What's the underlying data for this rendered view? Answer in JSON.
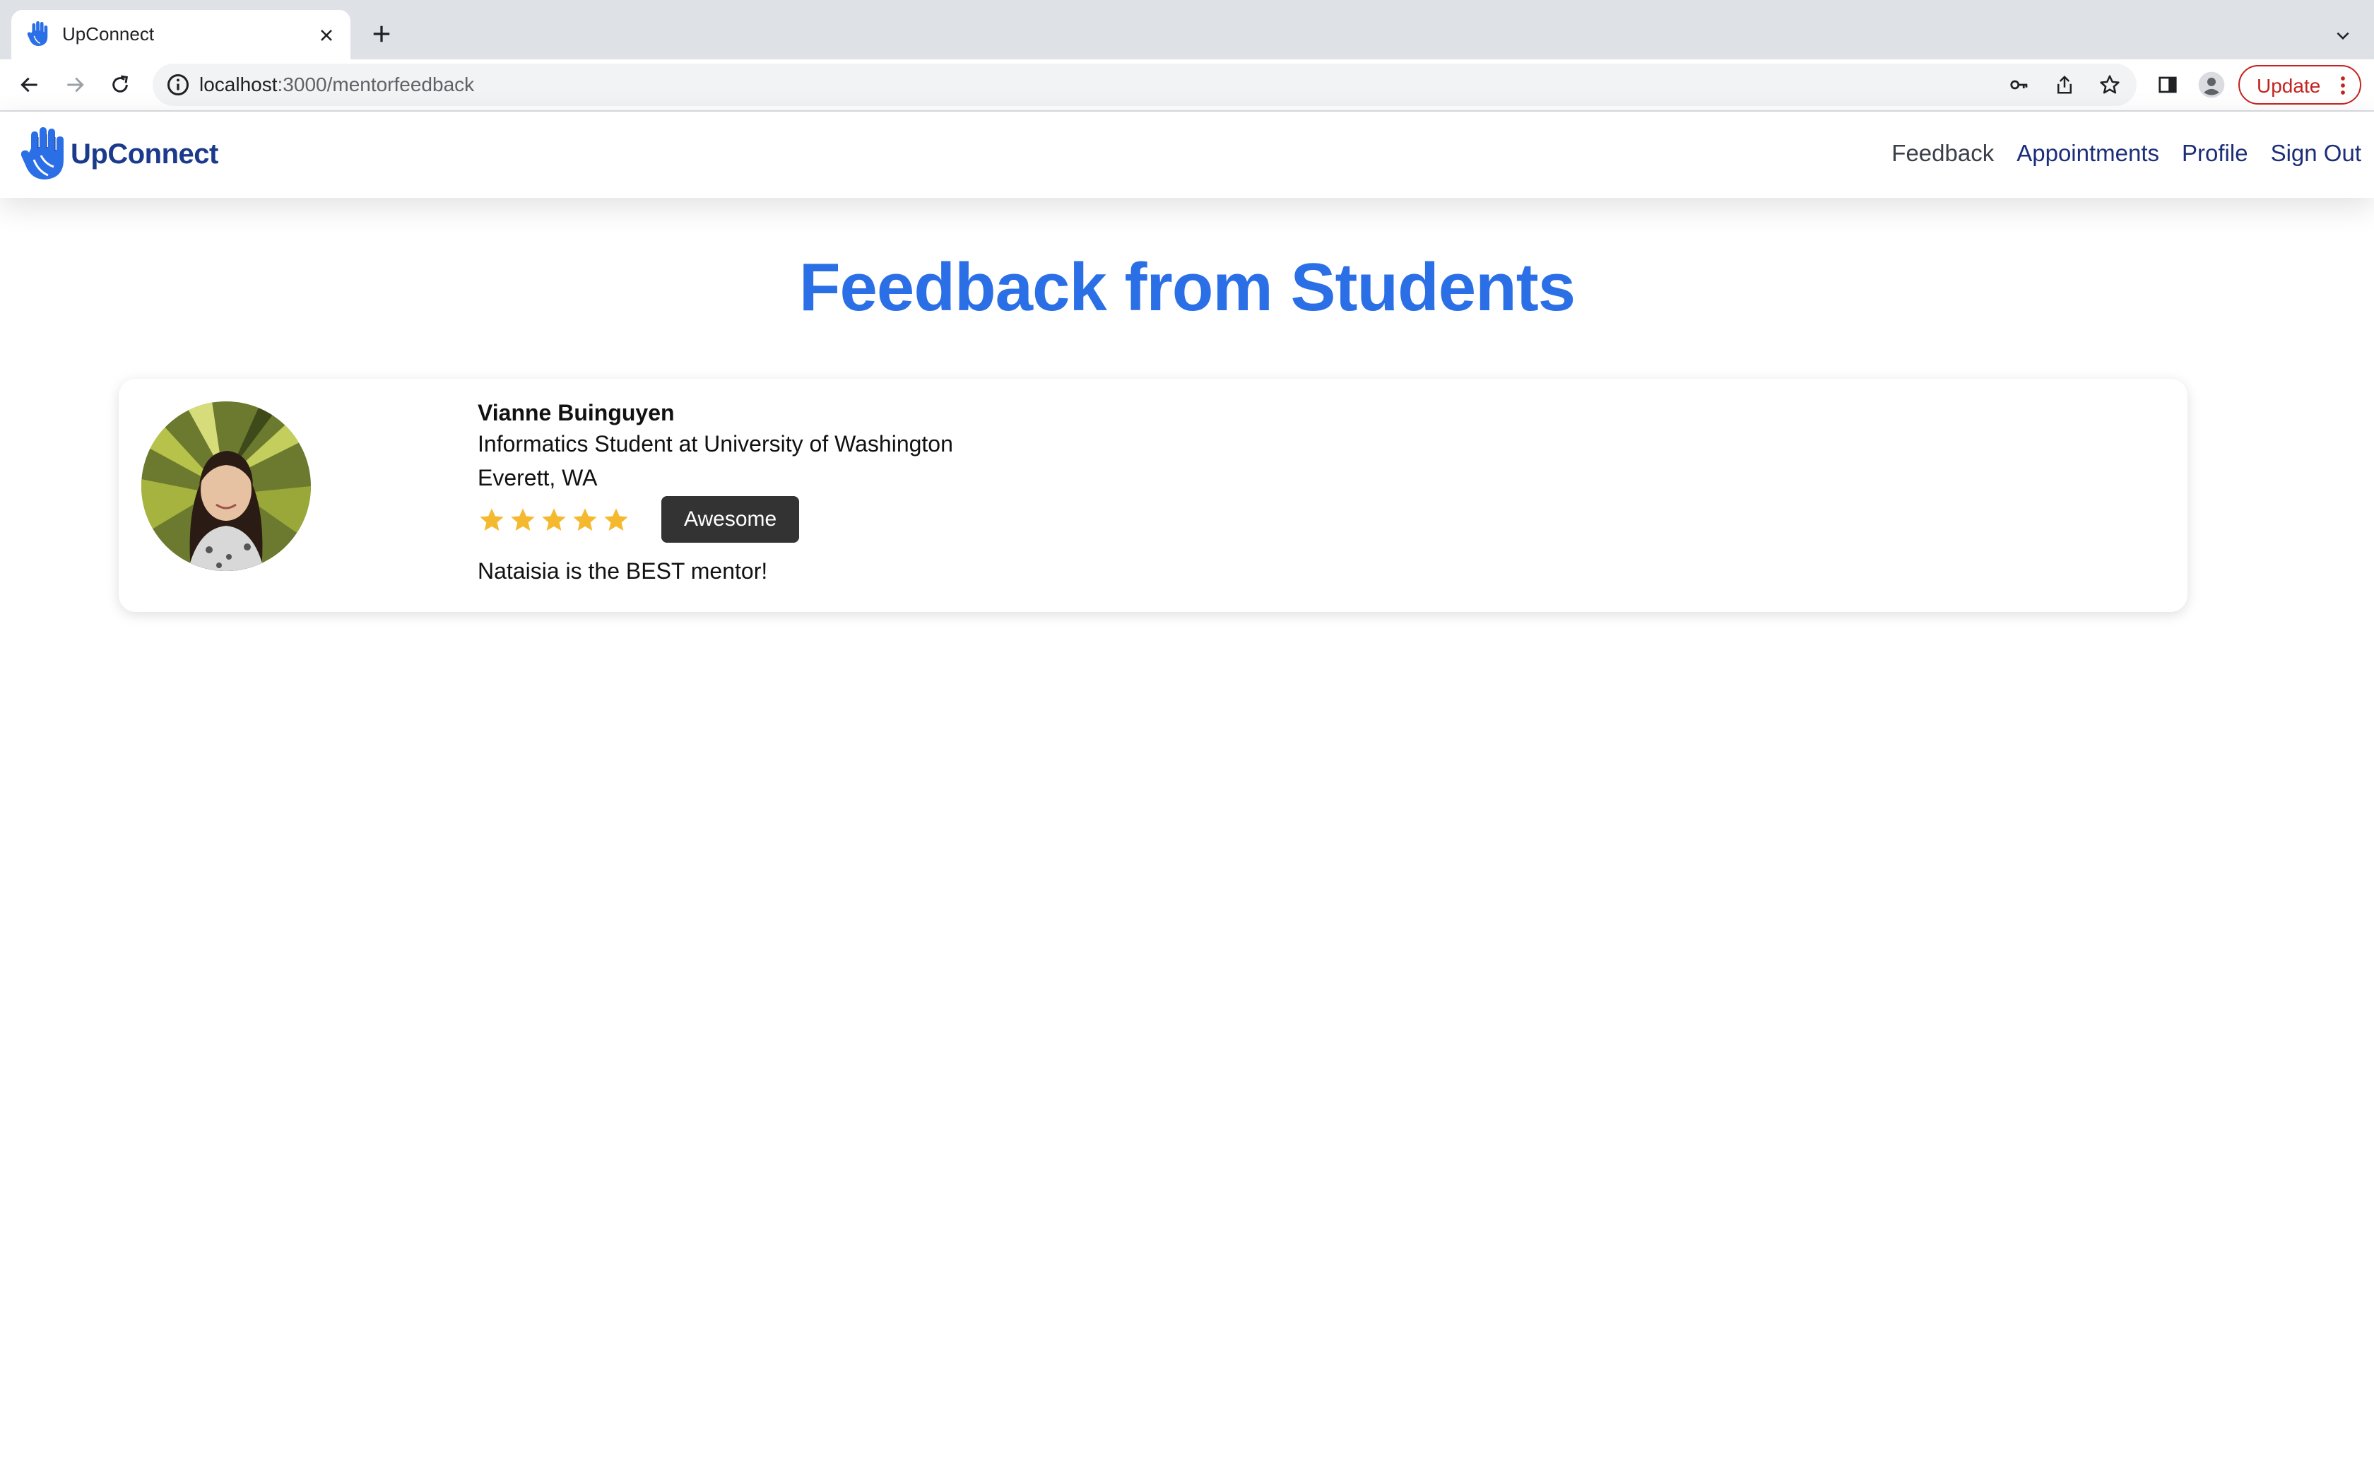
{
  "browser": {
    "tab_title": "UpConnect",
    "url_host": "localhost",
    "url_path": ":3000/mentorfeedback",
    "update_label": "Update"
  },
  "app": {
    "brand_name": "UpConnect",
    "nav": [
      {
        "label": "Feedback",
        "active": true
      },
      {
        "label": "Appointments",
        "active": false
      },
      {
        "label": "Profile",
        "active": false
      },
      {
        "label": "Sign Out",
        "active": false
      }
    ]
  },
  "page": {
    "title": "Feedback from Students"
  },
  "feedback": [
    {
      "name": "Vianne Buinguyen",
      "title": "Informatics Student at University of Washington",
      "location": "Everett, WA",
      "rating": 5,
      "rating_max": 5,
      "rating_label": "Awesome",
      "comment": "Nataisia is the BEST mentor!"
    }
  ],
  "colors": {
    "primary": "#2b6fe6",
    "brand": "#1c3a8c",
    "star": "#f4b92f",
    "badge": "#333333",
    "update": "#c5221f"
  },
  "icons": {
    "tab_favicon": "hand-logo-icon",
    "back": "arrow-left-icon",
    "forward": "arrow-right-icon",
    "reload": "reload-icon",
    "info": "info-icon",
    "key": "key-icon",
    "share": "share-icon",
    "bookmark": "star-outline-icon",
    "sidepanel": "side-panel-icon",
    "profile": "account-icon"
  }
}
